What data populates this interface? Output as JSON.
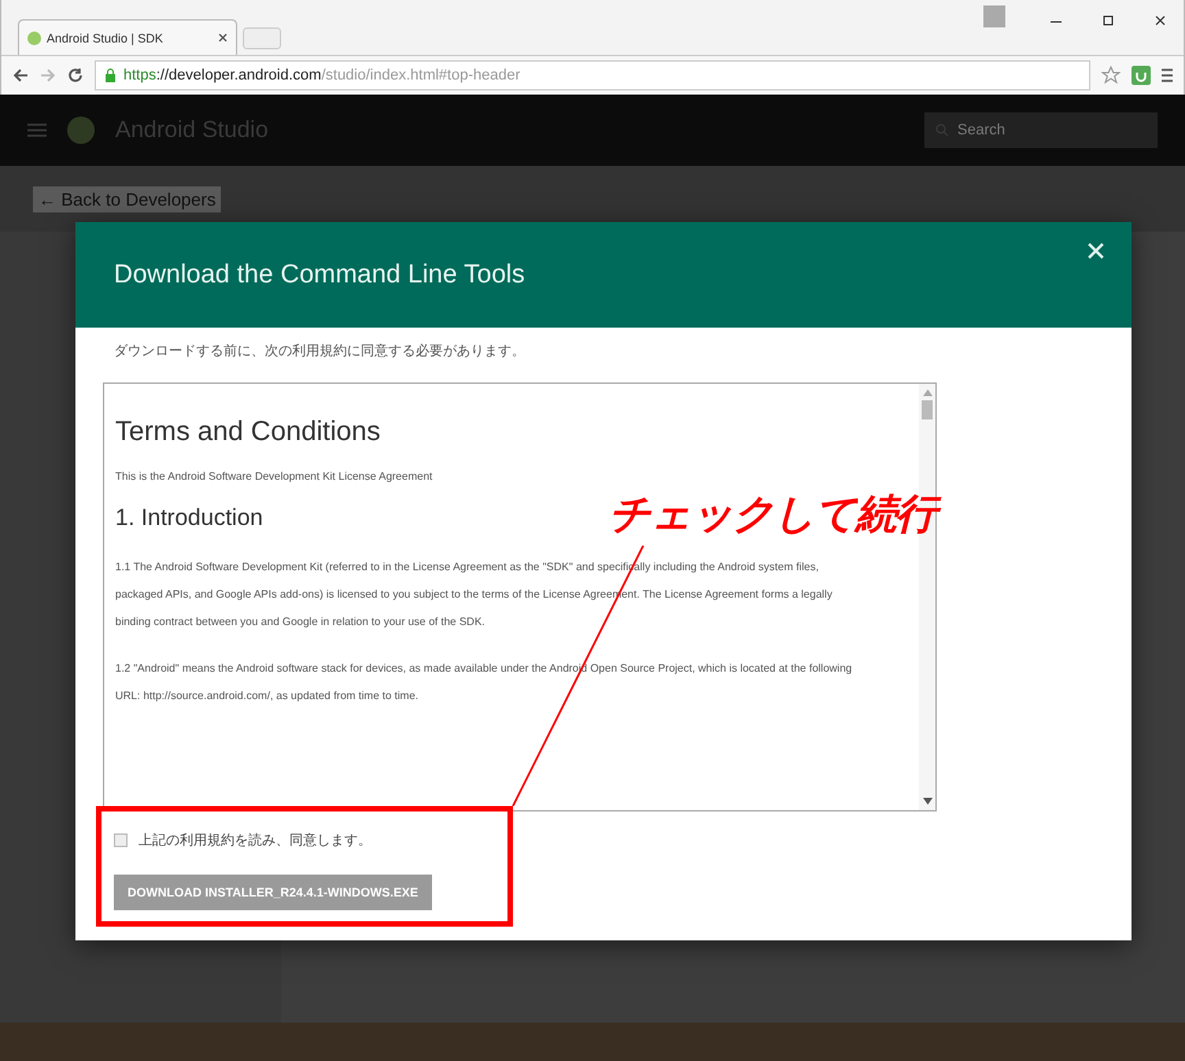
{
  "browser": {
    "tab_title": "Android Studio | SDK",
    "url_scheme": "https",
    "url_host": "://developer.android.com",
    "url_path": "/studio/index.html#top-header"
  },
  "site": {
    "name": "Android Studio",
    "back_link": "← Back to Developers",
    "search_placeholder": "Search"
  },
  "dialog": {
    "title": "Download the Command Line Tools",
    "intro": "ダウンロードする前に、次の利用規約に同意する必要があります。",
    "terms": {
      "heading": "Terms and Conditions",
      "subtitle": "This is the Android Software Development Kit License Agreement",
      "sections": [
        {
          "heading": "1. Introduction",
          "paragraphs": [
            "1.1 The Android Software Development Kit (referred to in the License Agreement as the \"SDK\" and specifically including the Android system files, packaged APIs, and Google APIs add-ons) is licensed to you subject to the terms of the License Agreement. The License Agreement forms a legally binding contract between you and Google in relation to your use of the SDK.",
            "1.2 \"Android\" means the Android software stack for devices, as made available under the Android Open Source Project, which is located at the following URL: http://source.android.com/, as updated from time to time."
          ]
        }
      ]
    },
    "agree": {
      "label": "上記の利用規約を読み、同意します。",
      "checked": false
    },
    "download_button": {
      "label": "DOWNLOAD INSTALLER_R24.4.1-WINDOWS.EXE",
      "disabled": true
    }
  },
  "annotation": {
    "text": "チェックして続行"
  }
}
